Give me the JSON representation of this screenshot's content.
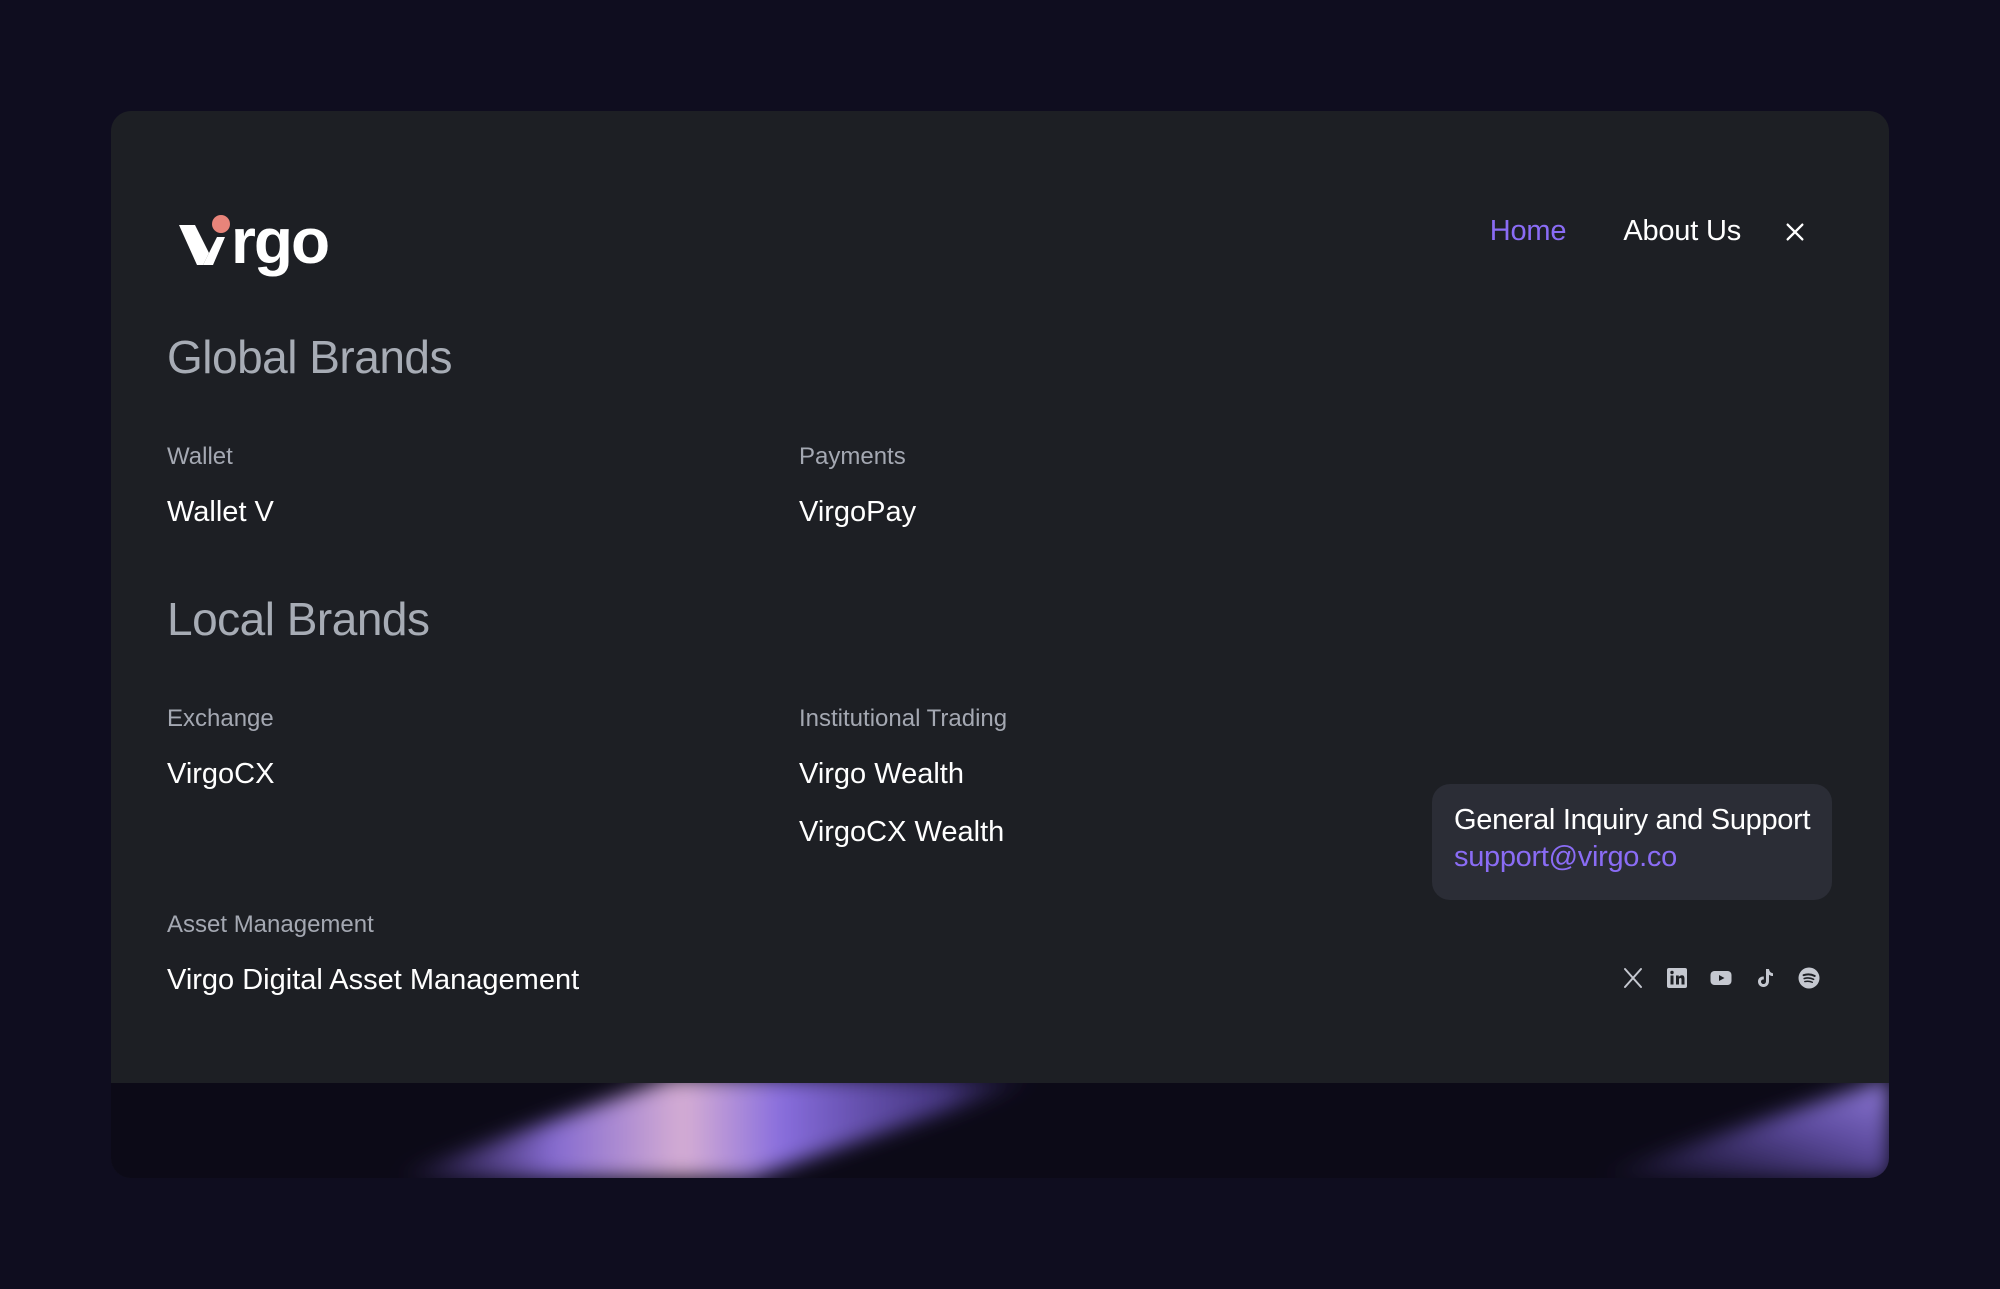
{
  "logo": {
    "text": "Virgo",
    "accent_color": "#e8847a"
  },
  "nav": {
    "items": [
      {
        "label": "Home",
        "active": true
      },
      {
        "label": "About Us",
        "active": false
      }
    ],
    "close_icon": "close-icon"
  },
  "global_brands": {
    "title": "Global Brands",
    "columns": [
      {
        "label": "Wallet",
        "links": [
          "Wallet V"
        ]
      },
      {
        "label": "Payments",
        "links": [
          "VirgoPay"
        ]
      }
    ]
  },
  "local_brands": {
    "title": "Local Brands",
    "columns": [
      {
        "label": "Exchange",
        "links": [
          "VirgoCX"
        ]
      },
      {
        "label": "Institutional Trading",
        "links": [
          "Virgo Wealth",
          "VirgoCX Wealth"
        ]
      },
      {
        "label": "Asset Management",
        "links": [
          "Virgo Digital Asset Management"
        ]
      }
    ]
  },
  "support": {
    "title": "General Inquiry and Support",
    "email": "support@virgo.co"
  },
  "socials": [
    "x-icon",
    "linkedin-icon",
    "youtube-icon",
    "tiktok-icon",
    "spotify-icon"
  ],
  "colors": {
    "background": "#0f0d1f",
    "card": "#1d1f24",
    "accent": "#8a6cf5",
    "muted_text": "#a7acb5",
    "support_box": "#2b2d36"
  }
}
